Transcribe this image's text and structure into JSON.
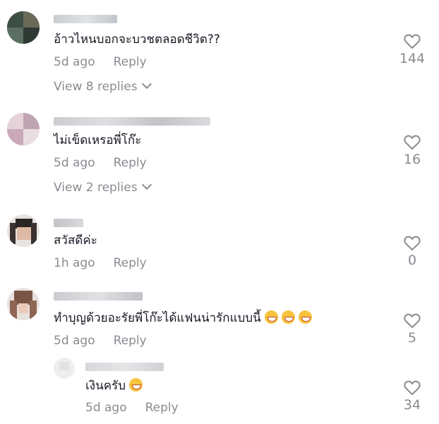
{
  "comments": [
    {
      "text": "อ้าวไหนบอกจะบวชตลอดชีวิต??",
      "time": "5d ago",
      "reply_label": "Reply",
      "likes": "144",
      "view_replies": "View 8 replies"
    },
    {
      "text": "ไม่เข็ดเหรอพี่โก๊ะ",
      "time": "5d ago",
      "reply_label": "Reply",
      "likes": "16",
      "view_replies": "View 2 replies"
    },
    {
      "text": "สวัสดีค่ะ",
      "time": "1h ago",
      "reply_label": "Reply",
      "likes": "0"
    },
    {
      "text": "ทำบุญด้วยอะรัยพี่โก๊ะได้แฟนน่ารักแบบนี้",
      "emoji_icons": [
        "grinning-face-icon",
        "grinning-face-icon",
        "tears-of-joy-icon"
      ],
      "time": "5d ago",
      "reply_label": "Reply",
      "likes": "5"
    }
  ],
  "reply": {
    "text": "เงินครับ",
    "emoji_icons": [
      "grinning-face-icon"
    ],
    "time": "5d ago",
    "reply_label": "Reply",
    "likes": "34"
  },
  "colors": {
    "text": "#161823",
    "meta": "#8a8b91",
    "background": "#ffffff"
  }
}
